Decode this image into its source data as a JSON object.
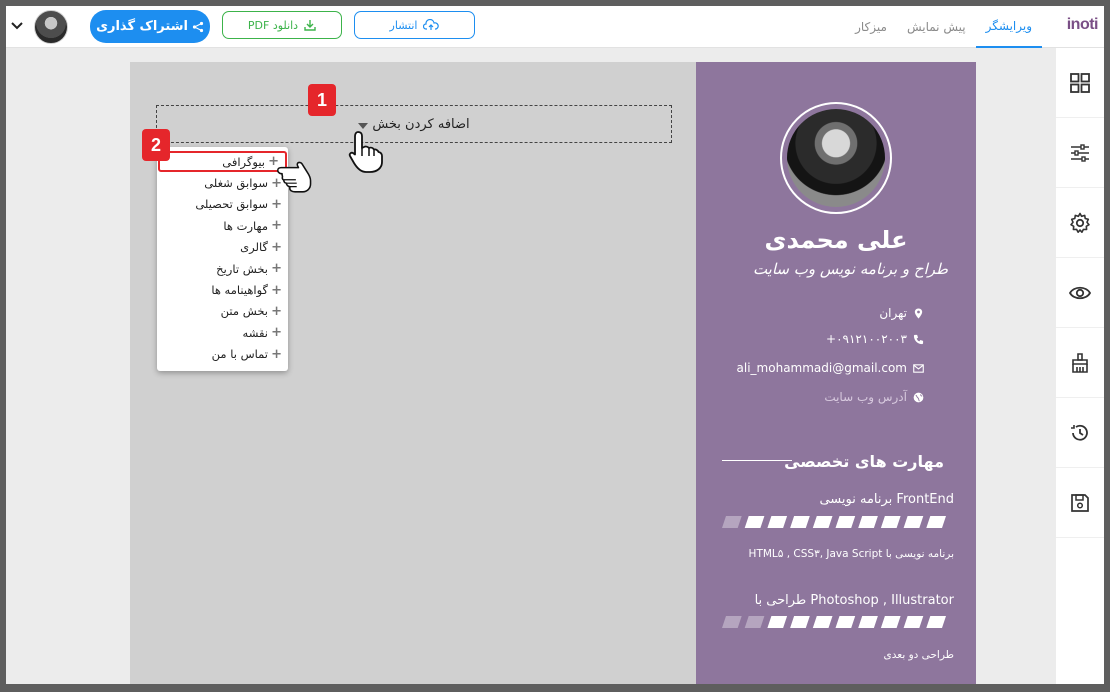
{
  "header": {
    "logo": "inoti",
    "tabs": [
      {
        "label": "ویرایشگر",
        "active": true
      },
      {
        "label": "پیش نمایش",
        "active": false
      },
      {
        "label": "میزکار",
        "active": false
      }
    ],
    "share_label": "اشتراک گذاری",
    "pdf_label": "دانلود PDF",
    "publish_label": "انتشار"
  },
  "editor": {
    "add_section_label": "اضافه کردن بخش",
    "menu_items": [
      "بیوگرافی",
      "سوابق شغلی",
      "سوابق تحصیلی",
      "مهارت ها",
      "گالری",
      "بخش تاریخ",
      "گواهینامه ها",
      "بخش متن",
      "نقشه",
      "تماس با من"
    ],
    "badge_1": "1",
    "badge_2": "2"
  },
  "profile": {
    "name": "علی محمدی",
    "title": "طراح و برنامه نویس وب سایت",
    "city": "تهران",
    "phone": "۰۹۱۲۱۰۰۲۰۰۳+",
    "email": "ali_mohammadi@gmail.com",
    "website_placeholder": "آدرس وب سایت",
    "skills_heading": "مهارت های تخصصی",
    "skills": [
      {
        "title": "برنامه نویسی FrontEnd",
        "desc": "برنامه نویسی با HTML۵ , CSS۳, Java Script",
        "level": 0.9
      },
      {
        "title": "طراحی با Photoshop , Illustrator",
        "desc": "طراحی دو بعدی",
        "level": 0.75
      }
    ]
  },
  "colors": {
    "accent": "#1d8ef0",
    "green": "#3cb34a",
    "sidebar": "#8e769d",
    "badge": "#e5262b",
    "logo": "#7a4f86"
  }
}
